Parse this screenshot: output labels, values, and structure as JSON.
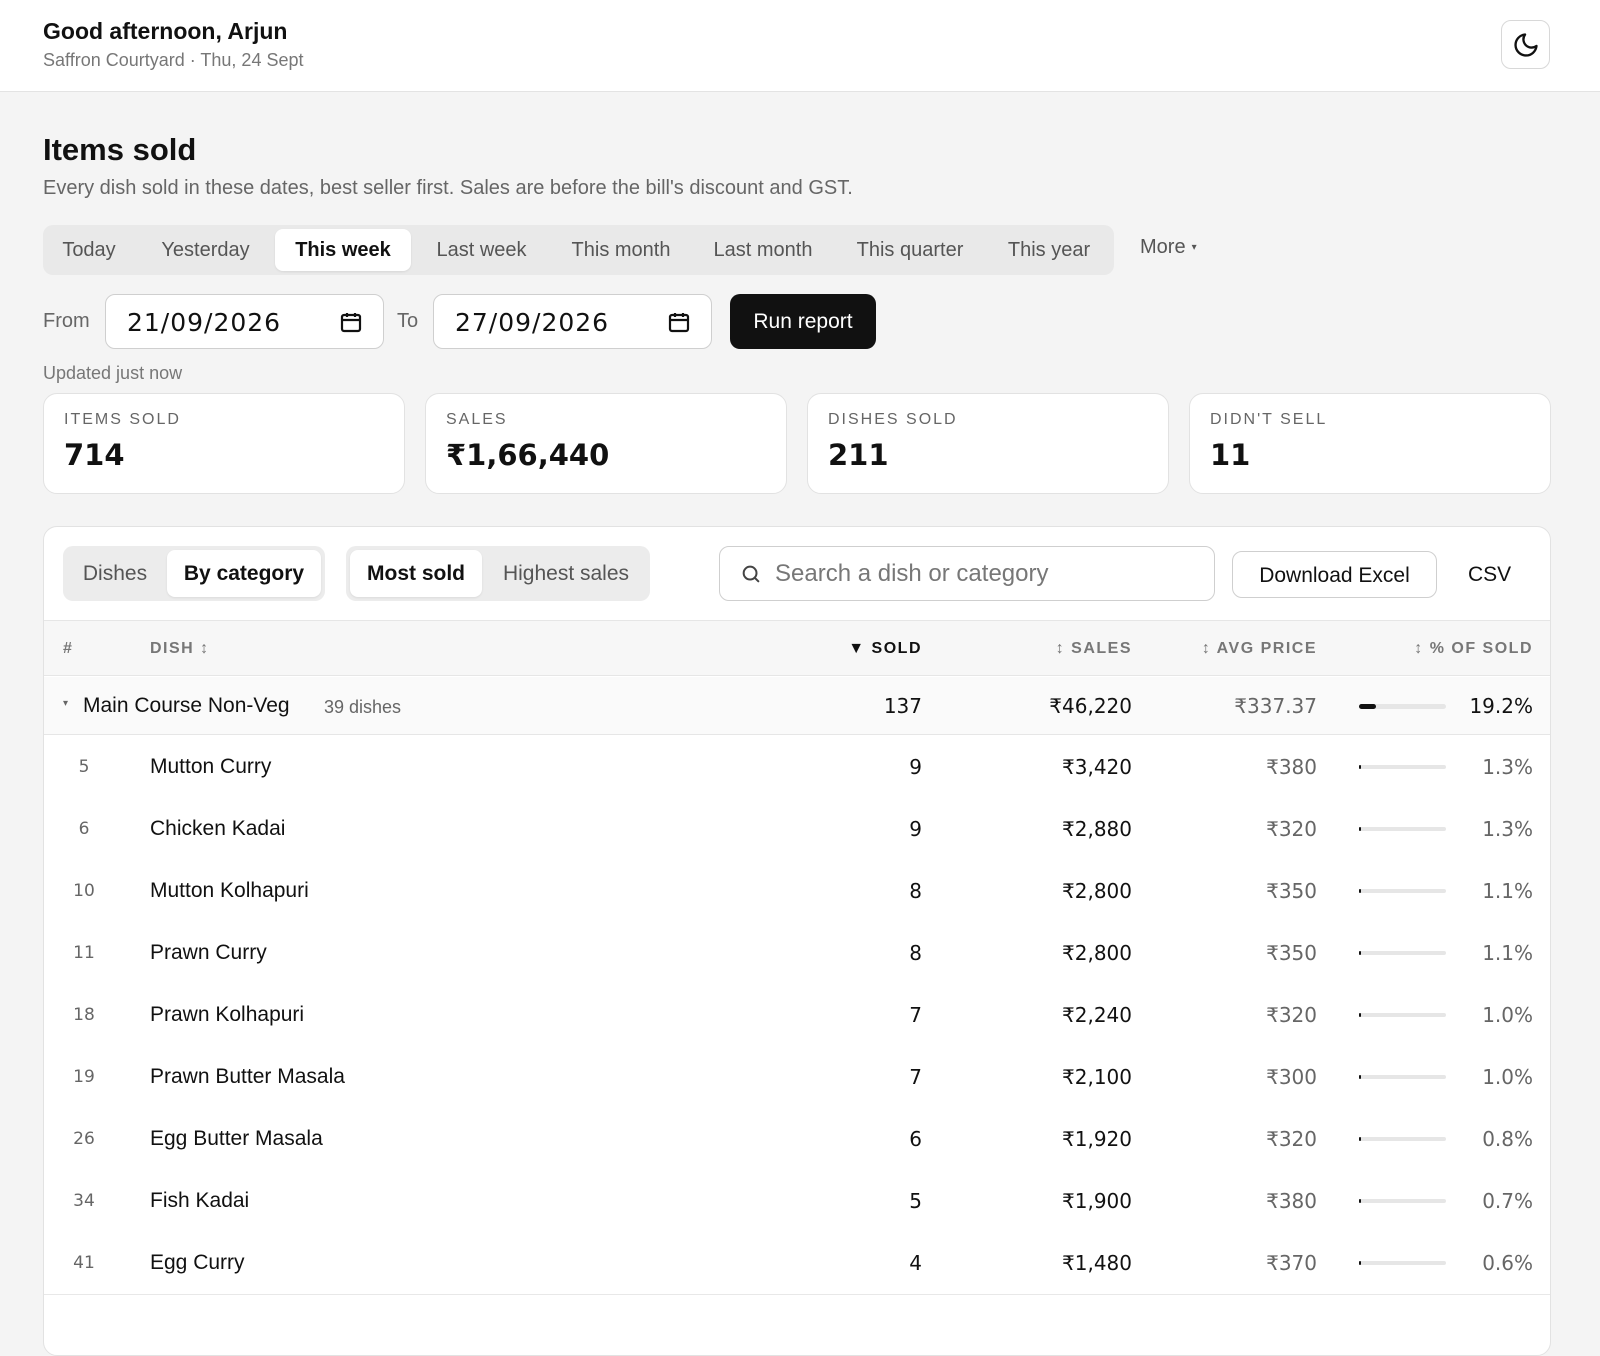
{
  "header": {
    "greeting": "Good afternoon, Arjun",
    "subline": "Saffron Courtyard · Thu, 24 Sept",
    "theme_icon": "moon-icon"
  },
  "page": {
    "title": "Items sold",
    "description": "Every dish sold in these dates, best seller first. Sales are before the bill's discount and GST."
  },
  "range_tabs": [
    "Today",
    "Yesterday",
    "This week",
    "Last week",
    "This month",
    "Last month",
    "This quarter",
    "This year"
  ],
  "range_active": "This week",
  "more_label": "More",
  "dates": {
    "from_label": "From",
    "from_value": "21/09/2026",
    "to_label": "To",
    "to_value": "27/09/2026",
    "run_label": "Run report",
    "updated": "Updated just now"
  },
  "stats": [
    {
      "label": "ITEMS SOLD",
      "value": "714"
    },
    {
      "label": "SALES",
      "value": "₹1,66,440"
    },
    {
      "label": "DISHES SOLD",
      "value": "211"
    },
    {
      "label": "DIDN'T SELL",
      "value": "11"
    }
  ],
  "toolbar": {
    "view_tabs": [
      "Dishes",
      "By category"
    ],
    "view_active": "By category",
    "sort_tabs": [
      "Most sold",
      "Highest sales"
    ],
    "sort_active": "Most sold",
    "search_placeholder": "Search a dish or category",
    "download_excel": "Download Excel",
    "csv": "CSV"
  },
  "table": {
    "headers": {
      "rank": "#",
      "dish": "DISH ↕",
      "sold": "▼ SOLD",
      "sales": "↕ SALES",
      "avg": "↕ AVG PRICE",
      "pct": "↕ % OF SOLD"
    },
    "group": {
      "name": "Main Course Non-Veg",
      "count": "39 dishes",
      "sold": "137",
      "sales": "₹46,220",
      "avg": "₹337.37",
      "pct": "19.2%",
      "share": 0.192
    },
    "rows": [
      {
        "rank": "5",
        "name": "Mutton Curry",
        "sold": "9",
        "sales": "₹3,420",
        "avg": "₹380",
        "pct": "1.3%",
        "share": 0.013
      },
      {
        "rank": "6",
        "name": "Chicken Kadai",
        "sold": "9",
        "sales": "₹2,880",
        "avg": "₹320",
        "pct": "1.3%",
        "share": 0.013
      },
      {
        "rank": "10",
        "name": "Mutton Kolhapuri",
        "sold": "8",
        "sales": "₹2,800",
        "avg": "₹350",
        "pct": "1.1%",
        "share": 0.011
      },
      {
        "rank": "11",
        "name": "Prawn Curry",
        "sold": "8",
        "sales": "₹2,800",
        "avg": "₹350",
        "pct": "1.1%",
        "share": 0.011
      },
      {
        "rank": "18",
        "name": "Prawn Kolhapuri",
        "sold": "7",
        "sales": "₹2,240",
        "avg": "₹320",
        "pct": "1.0%",
        "share": 0.01
      },
      {
        "rank": "19",
        "name": "Prawn Butter Masala",
        "sold": "7",
        "sales": "₹2,100",
        "avg": "₹300",
        "pct": "1.0%",
        "share": 0.01
      },
      {
        "rank": "26",
        "name": "Egg Butter Masala",
        "sold": "6",
        "sales": "₹1,920",
        "avg": "₹320",
        "pct": "0.8%",
        "share": 0.008
      },
      {
        "rank": "34",
        "name": "Fish Kadai",
        "sold": "5",
        "sales": "₹1,900",
        "avg": "₹380",
        "pct": "0.7%",
        "share": 0.007
      },
      {
        "rank": "41",
        "name": "Egg Curry",
        "sold": "4",
        "sales": "₹1,480",
        "avg": "₹370",
        "pct": "0.6%",
        "share": 0.006
      }
    ]
  }
}
